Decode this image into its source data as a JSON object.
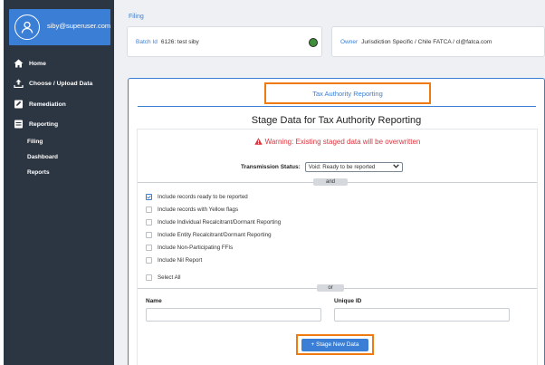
{
  "user": {
    "email": "siby@superuser.com",
    "icon": "user-avatar-icon"
  },
  "nav": {
    "home": "Home",
    "upload": "Choose / Upload Data",
    "remediation": "Remediation",
    "reporting": "Reporting",
    "sub": [
      "Filing",
      "Dashboard",
      "Reports"
    ]
  },
  "breadcrumb": "Filing",
  "batch": {
    "label": "Batch Id",
    "value": "6126: test siby",
    "status_color": "#3f8f3a"
  },
  "owner": {
    "label": "Owner",
    "value": "Jurisdiction Specific / Chile FATCA / cl@fatca.com"
  },
  "tab": {
    "label": "Tax Authority Reporting"
  },
  "stage": {
    "title": "Stage Data for Tax Authority Reporting",
    "warning": "Warning: Existing staged data will be overwritten",
    "transmission_label": "Transmission Status:",
    "transmission_value": "Void: Ready to be reported",
    "and_label": "and",
    "or_label": "or",
    "options": [
      {
        "label": "Include records ready to be reported",
        "checked": true
      },
      {
        "label": "Include records with Yellow flags",
        "checked": false
      },
      {
        "label": "Include Individual Recalcitrant/Dormant Reporting",
        "checked": false
      },
      {
        "label": "Include Entity Recalcitrant/Dormant Reporting",
        "checked": false
      },
      {
        "label": "Include Non-Participating FFIs",
        "checked": false
      },
      {
        "label": "Include Nil Report",
        "checked": false
      }
    ],
    "select_all": "Select All",
    "name_label": "Name",
    "uid_label": "Unique ID",
    "button_label": "+ Stage New Data"
  },
  "colors": {
    "sidebar": "#2c3542",
    "accent": "#3a7fd5",
    "highlight": "#f07a12",
    "warning": "#d9363e"
  }
}
